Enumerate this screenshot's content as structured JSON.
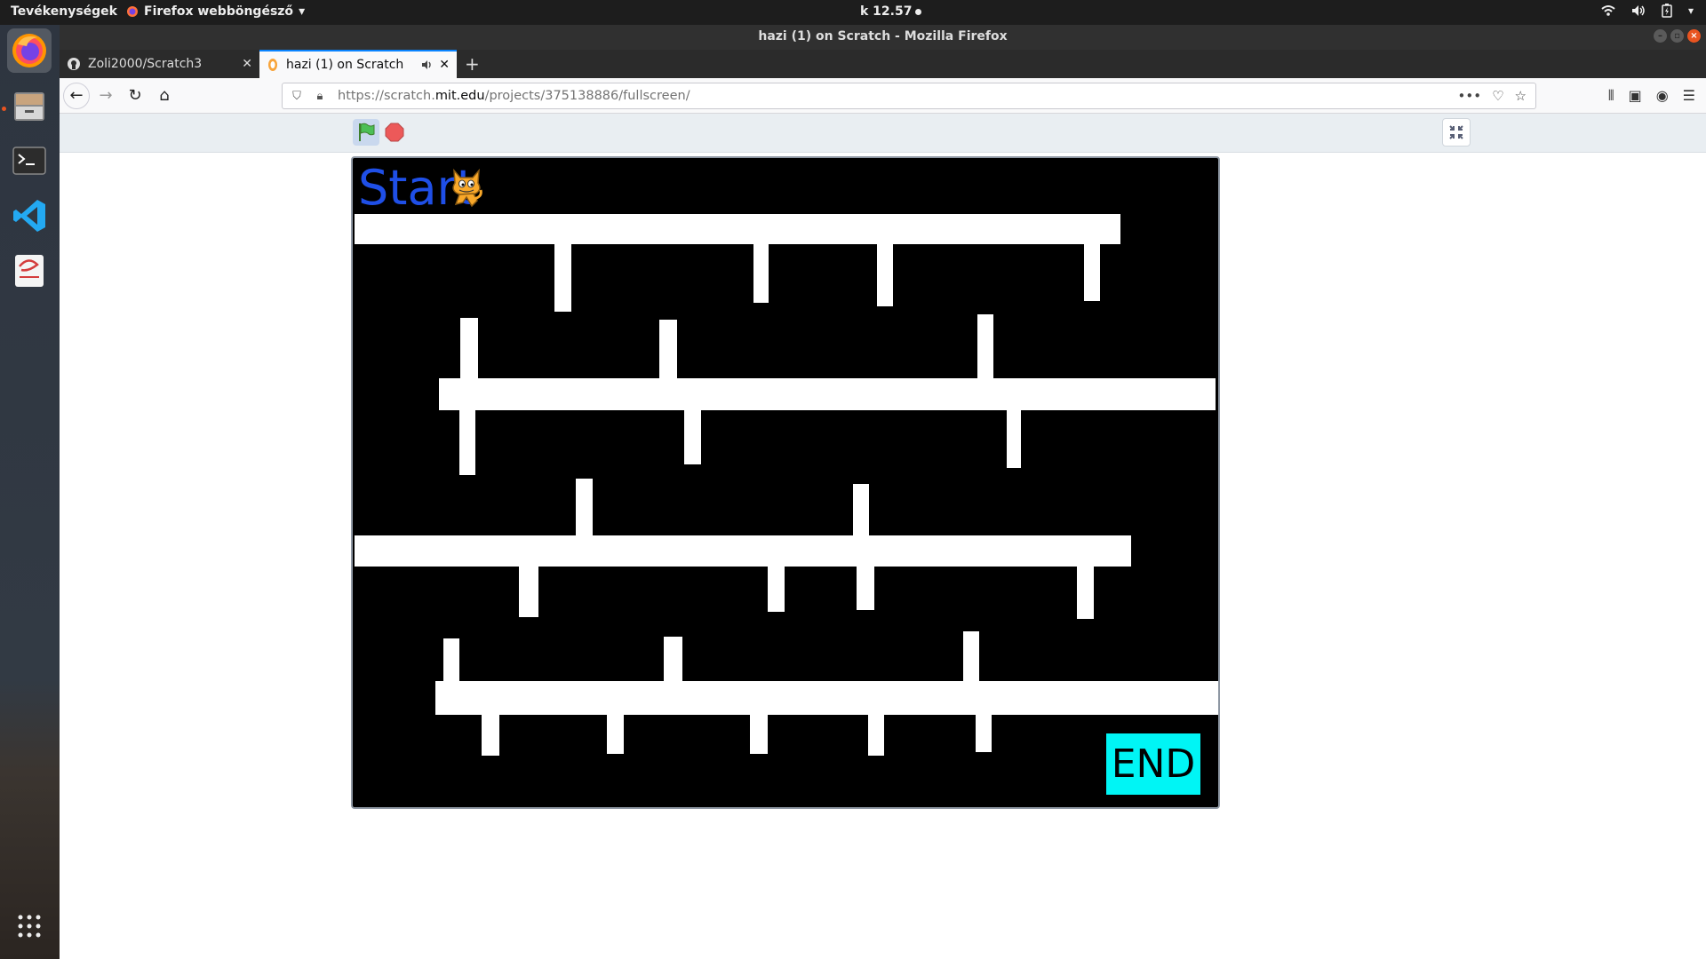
{
  "topbar": {
    "activities": "Tevékenységek",
    "app_menu": "Firefox webböngésző",
    "clock": "k 12.57"
  },
  "window": {
    "title": "hazi (1) on Scratch - Mozilla Firefox"
  },
  "tabs": [
    {
      "label": "Zoli2000/Scratch3",
      "active": false
    },
    {
      "label": "hazi (1) on Scratch",
      "active": true
    }
  ],
  "urlbar": {
    "prefix": "https://scratch.",
    "domain": "mit.edu",
    "path": "/projects/375138886/fullscreen/"
  },
  "stage": {
    "start_label": "Start",
    "end_label": "END",
    "end_color": "#00f5f5",
    "start_color": "#1f4fe7"
  },
  "colors": {
    "accent": "#e95420",
    "tab_accent": "#0a84ff"
  }
}
